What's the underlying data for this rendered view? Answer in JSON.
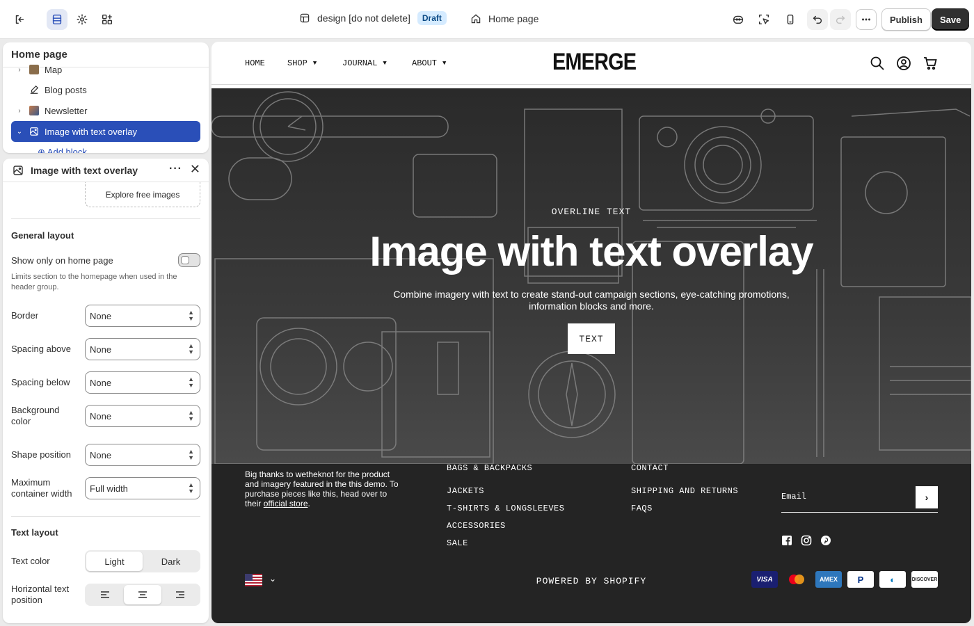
{
  "topbar": {
    "theme_name": "design [do not delete]",
    "status": "Draft",
    "page": "Home page",
    "publish_label": "Publish",
    "save_label": "Save"
  },
  "tree": {
    "title": "Home page",
    "items": [
      {
        "label": "Map"
      },
      {
        "label": "Blog posts"
      },
      {
        "label": "Newsletter"
      },
      {
        "label": "Image with text overlay"
      }
    ],
    "add_block": "Add block"
  },
  "settings": {
    "title": "Image with text overlay",
    "explore": "Explore free images",
    "general_title": "General layout",
    "home_only_label": "Show only on home page",
    "home_only_help": "Limits section to the homepage when used in the header group.",
    "border_label": "Border",
    "border_value": "None",
    "spacing_above_label": "Spacing above",
    "spacing_above_value": "None",
    "spacing_below_label": "Spacing below",
    "spacing_below_value": "None",
    "bg_label": "Background color",
    "bg_value": "None",
    "shape_label": "Shape position",
    "shape_value": "None",
    "max_width_label": "Maximum container width",
    "max_width_value": "Full width",
    "text_layout_title": "Text layout",
    "text_color_label": "Text color",
    "text_color_options": [
      "Light",
      "Dark"
    ],
    "hpos_label": "Horizontal text position"
  },
  "store": {
    "nav": [
      "HOME",
      "SHOP",
      "JOURNAL",
      "ABOUT"
    ],
    "logo": "EMERGE",
    "hero": {
      "overline": "OVERLINE TEXT",
      "title": "Image with text overlay",
      "text": "Combine imagery with text to create stand-out campaign sections, eye-catching promotions, information blocks and more.",
      "button": "TEXT"
    },
    "footer": {
      "about_pre": "Big thanks to wetheknot for the product and imagery featured in the this demo. To purchase pieces like this, head over to their ",
      "about_link": "official store",
      "about_post": ".",
      "col1": [
        "BAGS & BACKPACKS",
        "JACKETS",
        "T-SHIRTS & LONGSLEEVES",
        "ACCESSORIES",
        "SALE"
      ],
      "col2": [
        "CONTACT",
        "SHIPPING AND RETURNS",
        "FAQS"
      ],
      "email_placeholder": "Email",
      "powered": "POWERED BY SHOPIFY",
      "payments": [
        "VISA",
        "Mastercard",
        "AMEX",
        "PayPal",
        "Diners",
        "DISCOVER"
      ]
    }
  },
  "colors": {
    "accent": "#2a4fb8",
    "footer_bg": "#242424",
    "save_bg": "#303030"
  }
}
